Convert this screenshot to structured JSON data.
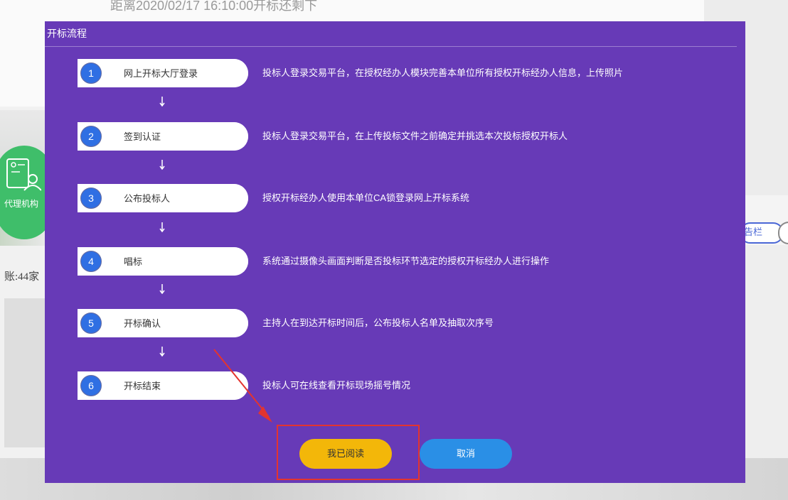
{
  "background": {
    "countdown_text": "距离2020/02/17 16:10:00开标还剩下",
    "agency_label": "代理机构",
    "count_text": "账:44家",
    "notice_label": "告栏"
  },
  "modal": {
    "title": "开标流程",
    "steps": [
      {
        "num": "1",
        "name": "网上开标大厅登录",
        "desc": "投标人登录交易平台，在授权经办人模块完善本单位所有授权开标经办人信息，上传照片"
      },
      {
        "num": "2",
        "name": "签到认证",
        "desc": "投标人登录交易平台，在上传投标文件之前确定并挑选本次投标授权开标人"
      },
      {
        "num": "3",
        "name": "公布投标人",
        "desc": "授权开标经办人使用本单位CA锁登录网上开标系统"
      },
      {
        "num": "4",
        "name": "唱标",
        "desc": "系统通过摄像头画面判断是否投标环节选定的授权开标经办人进行操作"
      },
      {
        "num": "5",
        "name": "开标确认",
        "desc": "主持人在到达开标时间后，公布投标人名单及抽取次序号"
      },
      {
        "num": "6",
        "name": "开标结束",
        "desc": "投标人可在线查看开标现场摇号情况"
      }
    ],
    "buttons": {
      "read": "我已阅读",
      "cancel": "取消"
    }
  },
  "colors": {
    "modal_bg": "#673ab7",
    "step_number_bg": "#2f6fe3",
    "read_button": "#f3b709",
    "cancel_button": "#2a8fe6",
    "annotation": "#e3342f"
  }
}
